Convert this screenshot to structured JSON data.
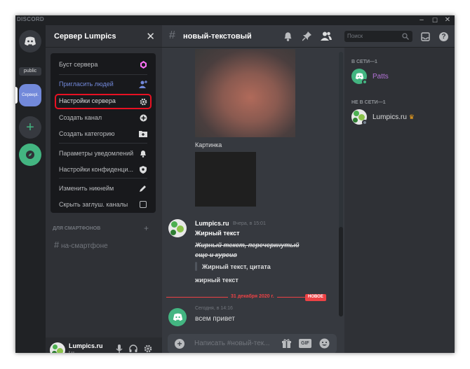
{
  "titlebar": {
    "brand": "DISCORD",
    "min": "–",
    "max": "☐",
    "close": "✕"
  },
  "guilds": {
    "public_label": "public",
    "selected_label": "Серверl.",
    "add": "+",
    "explore": "⌖"
  },
  "channel_header": {
    "title": "Сервер Lumpics",
    "close": "✕"
  },
  "context_menu": {
    "items": [
      {
        "label": "Буст сервера",
        "icon": "boost-icon",
        "color": "#b9bbbe"
      },
      {
        "label": "Пригласить людей",
        "icon": "add-user-icon",
        "color": "#7289da"
      },
      {
        "label": "Настройки сервера",
        "icon": "gear-icon",
        "color": "#b9bbbe"
      },
      {
        "label": "Создать канал",
        "icon": "plus-circle-icon",
        "color": "#b9bbbe"
      },
      {
        "label": "Создать категорию",
        "icon": "folder-plus-icon",
        "color": "#b9bbbe"
      },
      {
        "label": "Параметры уведомлений",
        "icon": "bell-icon",
        "color": "#b9bbbe"
      },
      {
        "label": "Настройки конфиденци...",
        "icon": "shield-icon",
        "color": "#b9bbbe"
      },
      {
        "label": "Изменить никнейм",
        "icon": "pencil-icon",
        "color": "#b9bbbe"
      },
      {
        "label": "Скрыть заглуш. каналы",
        "icon": "checkbox-icon",
        "color": "#b9bbbe"
      }
    ]
  },
  "channel_list": {
    "category": "ДЛЯ СМАРТФОНОВ",
    "channel": "на-смартфоне"
  },
  "user_panel": {
    "name": "Lumpics.ru",
    "tag": "Lu"
  },
  "main_header": {
    "channel": "новый-текстовый",
    "search_placeholder": "Поиск"
  },
  "messages": {
    "image_caption": "Картинка",
    "msg1": {
      "author": "Lumpics.ru",
      "time": "Вчера, в 15:01",
      "line1": "Жирный текст",
      "line2": "Жирный текст, перечеркнутый",
      "line3": "еще и курсив",
      "quote": "Жирный текст, цитата",
      "line4": "жирный текст"
    },
    "divider": {
      "date": "31 декабря 2020 г.",
      "badge": "НОВОЕ"
    },
    "msg2": {
      "time": "Сегодня, в 14:16",
      "text": "всем привет"
    }
  },
  "composer": {
    "placeholder": "Написать #новый-тек...",
    "gif": "GIF"
  },
  "members": {
    "online_header": "В СЕТИ—1",
    "online_user": "Patts",
    "offline_header": "НЕ В СЕТИ—1",
    "offline_user": "Lumpics.ru",
    "crown": "♛"
  },
  "colors": {
    "accent": "#7289da",
    "highlight": "#ed4245",
    "online": "#43b581",
    "badge": "#ed4245",
    "patts": "#b473d8"
  }
}
